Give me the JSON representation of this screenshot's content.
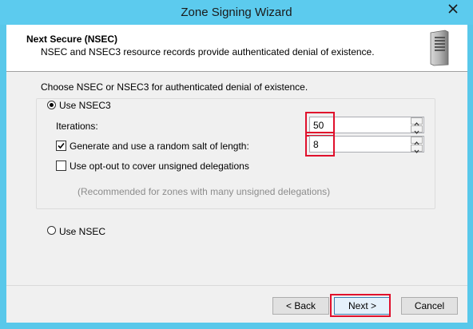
{
  "window": {
    "title": "Zone Signing Wizard",
    "close_icon": "close-icon"
  },
  "header": {
    "title": "Next Secure (NSEC)",
    "description": "NSEC and NSEC3 resource records provide authenticated denial of existence.",
    "icon": "server-icon"
  },
  "body": {
    "choose_label": "Choose NSEC or NSEC3 for authenticated denial of existence.",
    "nsec3": {
      "label": "Use NSEC3",
      "selected": true,
      "iterations_label": "Iterations:",
      "iterations_value": "50",
      "salt_label": "Generate and use a random salt of length:",
      "salt_checked": true,
      "salt_value": "8",
      "optout_label": "Use opt-out to cover unsigned delegations",
      "optout_checked": false,
      "optout_hint": "(Recommended for zones with many unsigned delegations)"
    },
    "nsec": {
      "label": "Use NSEC",
      "selected": false
    }
  },
  "buttons": {
    "back": "< Back",
    "next": "Next >",
    "cancel": "Cancel"
  },
  "colors": {
    "titlebar": "#5ccbee",
    "highlight": "#e0102c"
  }
}
